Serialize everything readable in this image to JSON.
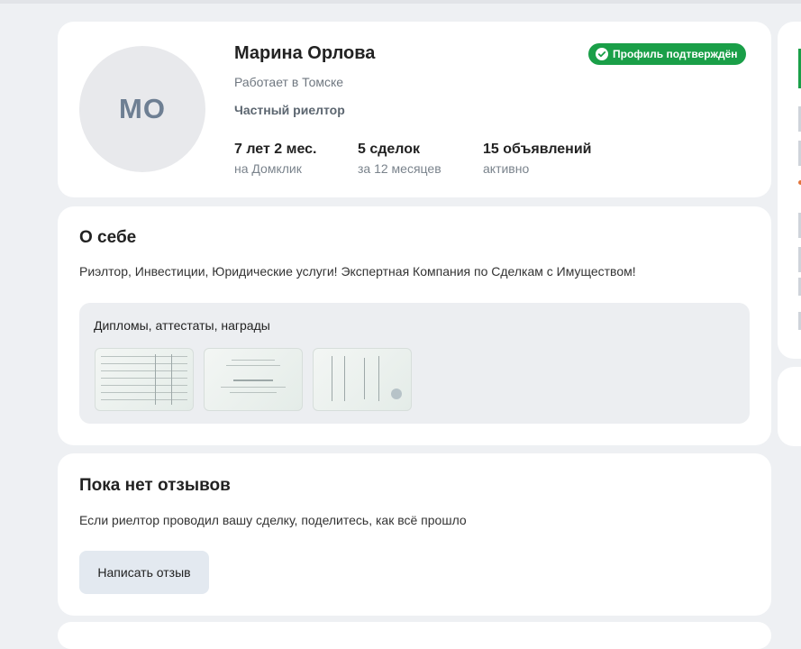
{
  "profile": {
    "initials": "МО",
    "name": "Марина Орлова",
    "city": "Работает в Томске",
    "role": "Частный риелтор",
    "verified_label": "Профиль подтверждён",
    "stats": [
      {
        "value": "7 лет 2 мес.",
        "sub": "на Домклик"
      },
      {
        "value": "5 сделок",
        "sub": "за 12 месяцев"
      },
      {
        "value": "15 объявлений",
        "sub": "активно"
      }
    ]
  },
  "about": {
    "title": "О себе",
    "text": "Риэлтор, Инвестиции, Юридические услуги! Экспертная Компания по Сделкам с Имуществом!",
    "diplomas_title": "Дипломы, аттестаты, награды"
  },
  "reviews": {
    "title": "Пока нет отзывов",
    "text": "Если риелтор проводил вашу сделку, поделитесь, как всё прошло",
    "button_label": "Написать отзыв"
  },
  "colors": {
    "accent_green": "#1a9f48",
    "page_bg": "#eef0f3"
  }
}
